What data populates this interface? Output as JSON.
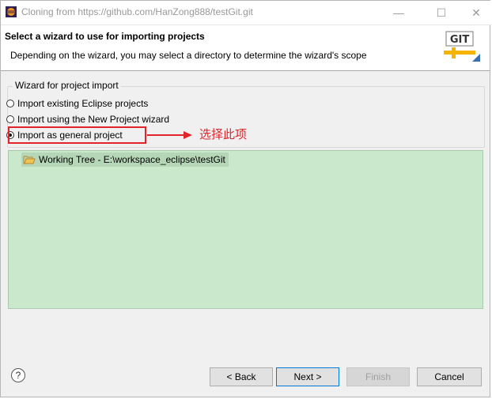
{
  "window": {
    "title": "Cloning from https://github.com/HanZong888/testGit.git",
    "controls": {
      "minimize": "—",
      "maximize": "☐",
      "close": "✕"
    }
  },
  "header": {
    "title": "Select a wizard to use for importing projects",
    "description": "Depending on the wizard, you may select a directory to determine the wizard's scope",
    "logo_text": "GIT"
  },
  "wizard_group": {
    "legend": "Wizard for project import",
    "options": [
      {
        "label": "Import existing Eclipse projects",
        "checked": false
      },
      {
        "label": "Import using the New Project wizard",
        "checked": false
      },
      {
        "label": "Import as general project",
        "checked": true
      }
    ]
  },
  "annotation": {
    "text": "选择此项",
    "color": "#e0242a"
  },
  "tree": {
    "items": [
      {
        "label": "Working Tree - E:\\workspace_eclipse\\testGit",
        "icon": "folder-open-icon"
      }
    ]
  },
  "footer": {
    "help_label": "?",
    "back_label": "< Back",
    "next_label": "Next >",
    "finish_label": "Finish",
    "cancel_label": "Cancel"
  },
  "colors": {
    "tree_bg": "#c9e8cc",
    "accent": "#0078d7"
  }
}
